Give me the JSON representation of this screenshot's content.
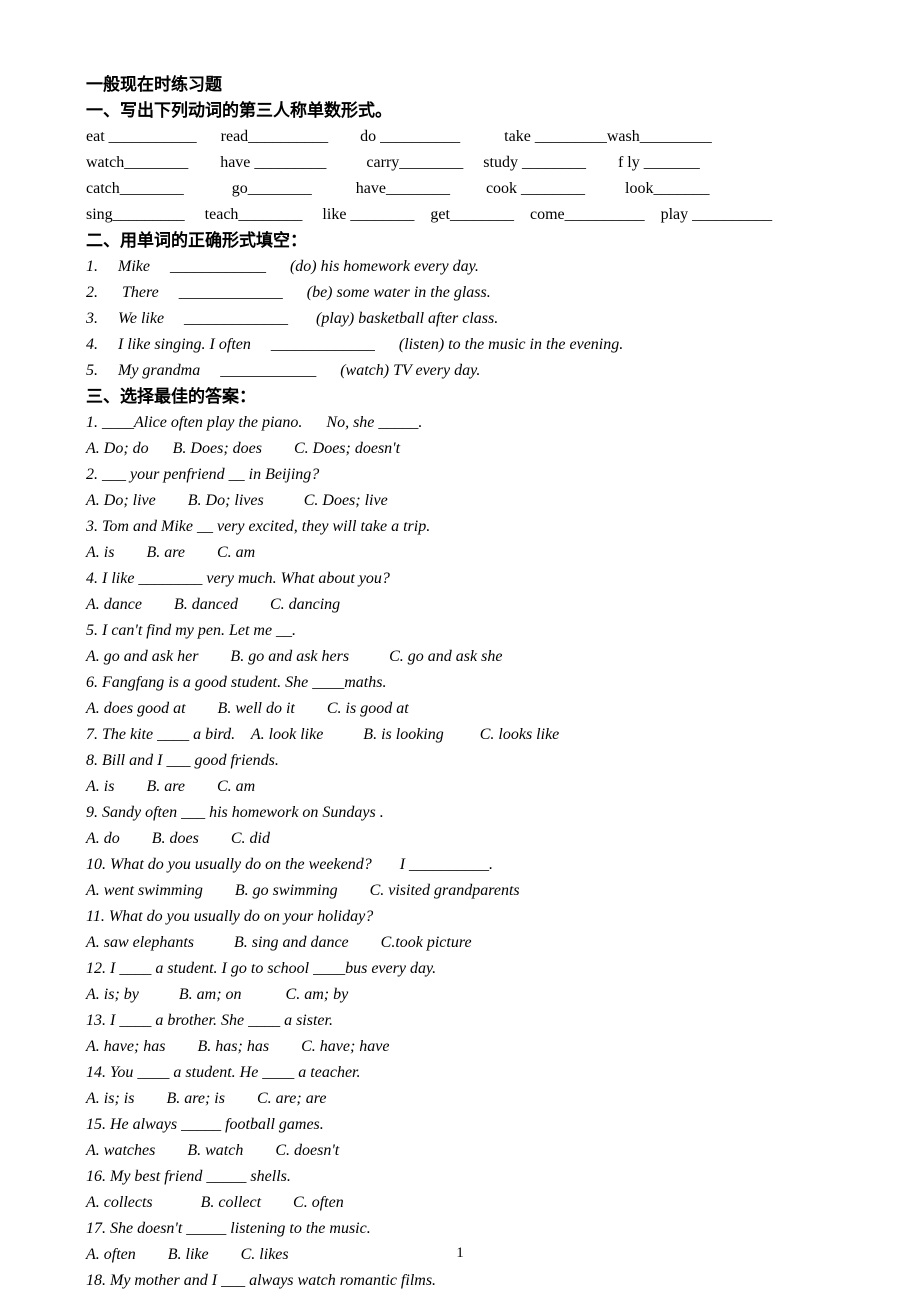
{
  "title": "一般现在时练习题",
  "section1": {
    "heading": "一、写出下列动词的第三人称单数形式。",
    "rows": [
      "eat ___________      read__________        do __________           take _________wash_________",
      "watch________        have _________          carry________     study ________        f ly _______",
      "catch________            go________           have________         cook ________          look_______",
      "sing_________     teach________     like ________    get________    come__________    play __________"
    ]
  },
  "section2": {
    "heading": "二、用单词的正确形式填空：",
    "items": [
      "1.     Mike     ____________      (do) his homework every day.",
      "2.      There     _____________      (be) some water in the glass.",
      "3.     We like     _____________       (play) basketball after class.",
      "4.     I like singing. I often     _____________      (listen) to the music in the evening.",
      "5.     My grandma     ____________      (watch) TV every day."
    ]
  },
  "section3": {
    "heading": "三、选择最佳的答案：",
    "items": [
      "1. ____Alice often play the piano.      No, she _____.",
      "A. Do; do      B. Does; does        C. Does; doesn't",
      "2. ___ your penfriend __ in Beijing?",
      "A. Do; live        B. Do; lives          C. Does; live",
      "3. Tom and Mike __ very excited, they will take a trip.",
      "A. is        B. are        C. am",
      "4. I like ________ very much. What about you?",
      "A. dance        B. danced        C. dancing",
      "5. I can't find my pen. Let me __.",
      "A. go and ask her        B. go and ask hers          C. go and ask she",
      "6. Fangfang is a good student. She ____maths.",
      "A. does good at        B. well do it        C. is good at",
      "7. The kite ____ a bird.    A. look like          B. is looking         C. looks like",
      "8. Bill and I ___ good friends.",
      "A. is        B. are        C. am",
      "9. Sandy often ___ his homework on Sundays .",
      "A. do        B. does        C. did",
      "10. What do you usually do on the weekend?       I __________.",
      "A. went swimming        B. go swimming        C. visited grandparents",
      "11. What do you usually do on your holiday?",
      "A. saw elephants          B. sing and dance        C.took picture",
      "12. I ____ a student. I go to school ____bus every day.",
      "A. is; by          B. am; on           C. am; by",
      "13. I ____ a brother. She ____ a sister.",
      "A. have; has        B. has; has        C. have; have",
      "14. You ____ a student. He ____ a teacher.",
      "A. is; is        B. are; is        C. are; are",
      "15. He always _____ football games.",
      "A. watches        B. watch        C. doesn't",
      "16. My best friend _____ shells.",
      "A. collects            B. collect        C. often",
      "17. She doesn't _____ listening to the music.",
      "A. often        B. like        C. likes",
      "18. My mother and I ___ always watch romantic films."
    ]
  },
  "page_number": "1"
}
